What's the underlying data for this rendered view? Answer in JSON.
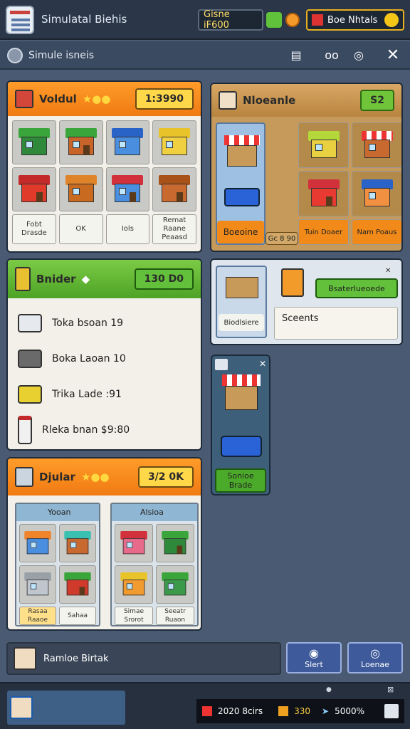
{
  "window": {
    "title": "Simulatal Biehis"
  },
  "topbar": {
    "money": "Gisne iF600",
    "status": "Boe Nhtals"
  },
  "subbar": {
    "title": "Simule isneis"
  },
  "panel_a": {
    "title": "Voldul",
    "value": "1:3990",
    "labels": [
      "Fobt Drasde",
      "OK",
      "Iols",
      "Remat Raane Peaasd"
    ]
  },
  "panel_b": {
    "title": "Nloeanle",
    "value": "S2",
    "labels": [
      "Boeoine",
      "Gc 8 90",
      "Tuin Doaer",
      "Nam Poaus"
    ]
  },
  "panel_c": {
    "title": "Bnider",
    "value": "130 D0",
    "items": [
      {
        "label": "Toka bsoan 19",
        "icon": "server-icon"
      },
      {
        "label": "Boka Laoan 10",
        "icon": "printer-icon"
      },
      {
        "label": "Trika Lade :91",
        "icon": "truck-icon"
      },
      {
        "label": "Rleka bnan $9:80",
        "icon": "bottle-icon"
      }
    ]
  },
  "panel_d": {
    "card_label": "Biodlsiere",
    "button": "Bsaterlueoede",
    "field": "Sceents"
  },
  "panel_e": {
    "button": "Sonioe Brade"
  },
  "panel_f": {
    "title": "Djular",
    "value": "3/2 0K",
    "sub1": "Yooan",
    "sub2": "Alsioa",
    "labels1": [
      "Rasaa Raaoe",
      "Sahaa"
    ],
    "labels2": [
      "Simae Srorot",
      "Seeatr Ruaon"
    ]
  },
  "footer": {
    "name": "Ramloe Birtak",
    "btn1": "Slert",
    "btn2": "Loenae"
  },
  "status": {
    "stat1": "2020 8cirs",
    "stat2": "330",
    "stat3": "5000%"
  },
  "colors": {
    "accent_orange": "#f07a12",
    "accent_green": "#4da326",
    "panel_bg": "#f2f0e8",
    "bg": "#4a5a72"
  }
}
